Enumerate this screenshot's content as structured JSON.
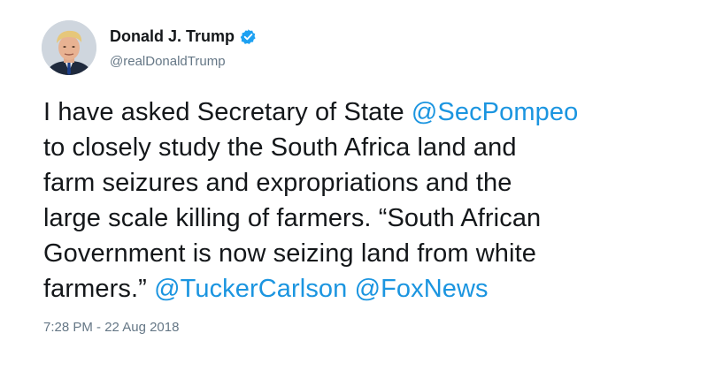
{
  "author": {
    "display_name": "Donald J. Trump",
    "handle": "@realDonaldTrump",
    "verified": true,
    "avatar_icon": "profile-photo"
  },
  "tweet": {
    "line1_text": "I have asked Secretary of State ",
    "line1_mention": "@SecPompeo",
    "line2": "to closely study the South Africa land and",
    "line3": "farm seizures and expropriations and the",
    "line4": "large scale killing of farmers. “South African",
    "line5": "Government is now seizing land from white",
    "line6_text": "farmers.” ",
    "line6_mention1": "@TuckerCarlson",
    "line6_space": " ",
    "line6_mention2": "@FoxNews"
  },
  "timestamp": "7:28 PM - 22 Aug 2018",
  "colors": {
    "link": "#1b95e0",
    "text": "#14171a",
    "secondary": "#657786",
    "verified": "#1da1f2"
  }
}
